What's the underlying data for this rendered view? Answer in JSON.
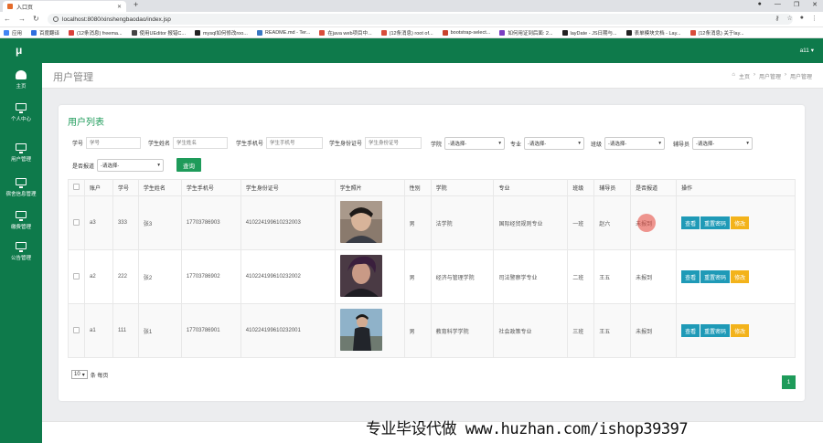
{
  "browser": {
    "tab_title": "入口页",
    "url": "localhost:8080/xinshengbaodao/index.jsp",
    "bookmarks": [
      "应用",
      "百度翻译",
      "(12条消息) freema...",
      "使用UEditor 报错C...",
      "mysql如何修改roo...",
      "README.md - Ter...",
      "在java web项目中...",
      "(12条消息) root of...",
      "bootstrap-select...",
      "如何用证到后面: 2...",
      "layDate - JS日期与...",
      "表单模块文档 - Lay...",
      "(12条消息) 关于lay..."
    ]
  },
  "app": {
    "logo": "μ",
    "user_label": "a11 ▾"
  },
  "sidebar": {
    "items": [
      {
        "label": "主页",
        "icon": "dashboard-icon"
      },
      {
        "label": "个人中心",
        "icon": "monitor-icon"
      },
      {
        "label": "用户管理",
        "icon": "monitor-icon"
      },
      {
        "label": "宿舍信息管理",
        "icon": "monitor-icon"
      },
      {
        "label": "缴费管理",
        "icon": "monitor-icon"
      },
      {
        "label": "公告管理",
        "icon": "monitor-icon"
      }
    ]
  },
  "page": {
    "title": "用户管理",
    "breadcrumb": [
      "主页",
      "用户管理",
      "用户管理"
    ]
  },
  "card": {
    "title": "用户列表"
  },
  "filters": {
    "student_no": {
      "label": "学号",
      "placeholder": "学号"
    },
    "student_name": {
      "label": "学生姓名",
      "placeholder": "学生姓名"
    },
    "student_phone": {
      "label": "学生手机号",
      "placeholder": "学生手机号"
    },
    "student_id_card": {
      "label": "学生身份证号",
      "placeholder": "学生身份证号"
    },
    "college": {
      "label": "学院",
      "value": "-请选择-"
    },
    "major": {
      "label": "专业",
      "value": "-请选择-"
    },
    "class": {
      "label": "班级",
      "value": "-请选择-"
    },
    "counselor": {
      "label": "辅导员",
      "value": "-请选择-"
    },
    "reported": {
      "label": "是否报道",
      "value": "-请选择-"
    },
    "query_button": "查询"
  },
  "table": {
    "headers": [
      "",
      "账户",
      "学号",
      "学生姓名",
      "学生手机号",
      "学生身份证号",
      "学生照片",
      "性别",
      "学院",
      "专业",
      "班级",
      "辅导员",
      "是否报道",
      "操作"
    ],
    "rows": [
      {
        "account": "a3",
        "no": "333",
        "name": "张3",
        "phone": "17703786903",
        "id_card": "410224199610232003",
        "gender": "男",
        "college": "法学院",
        "major": "国际经贸规则专业",
        "class": "一班",
        "counselor": "赵六",
        "reported": "未报到"
      },
      {
        "account": "a2",
        "no": "222",
        "name": "张2",
        "phone": "17703786902",
        "id_card": "410224199610232002",
        "gender": "男",
        "college": "经济与管理学院",
        "major": "司法警察学专业",
        "class": "二班",
        "counselor": "王五",
        "reported": "未报到"
      },
      {
        "account": "a1",
        "no": "111",
        "name": "张1",
        "phone": "17703786901",
        "id_card": "410224199610232001",
        "gender": "男",
        "college": "教育科学学院",
        "major": "社会政策专业",
        "class": "三班",
        "counselor": "王五",
        "reported": "未报到"
      }
    ],
    "actions": {
      "view": "查看",
      "reset": "重置密码",
      "edit": "修改"
    }
  },
  "pagination": {
    "page_size": "10",
    "per_page_text": "条 每页",
    "current_page": "1"
  },
  "watermark": "专业毕设代做 www.huzhan.com/ishop39397",
  "colors": {
    "primary": "#0e7a4b",
    "accent": "#1e9b5a",
    "info": "#1f9ab7",
    "warning": "#f3b31b"
  }
}
